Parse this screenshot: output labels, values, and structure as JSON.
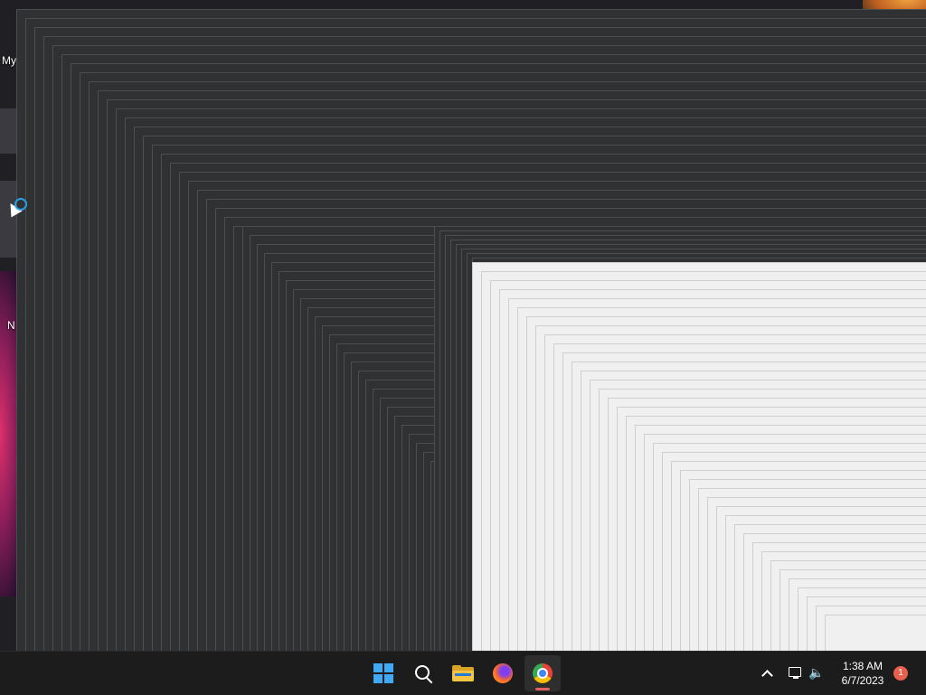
{
  "desktop": {
    "icon_label_1": "My",
    "icon_label_2": "N"
  },
  "taskbar": {
    "apps": [
      {
        "name": "Start",
        "icon": "windows-logo-icon"
      },
      {
        "name": "Search",
        "icon": "search-icon"
      },
      {
        "name": "File Explorer",
        "icon": "folder-icon"
      },
      {
        "name": "Firefox",
        "icon": "firefox-icon"
      },
      {
        "name": "Google Chrome",
        "icon": "chrome-icon",
        "active": true
      }
    ],
    "accent_color": "#3fa9f5",
    "active_indicator_color": "#e06060"
  },
  "tray": {
    "time": "1:38 AM",
    "date": "6/7/2023",
    "notification_count": "1",
    "icons": [
      "chevron-up-icon",
      "network-icon",
      "volume-icon"
    ]
  }
}
